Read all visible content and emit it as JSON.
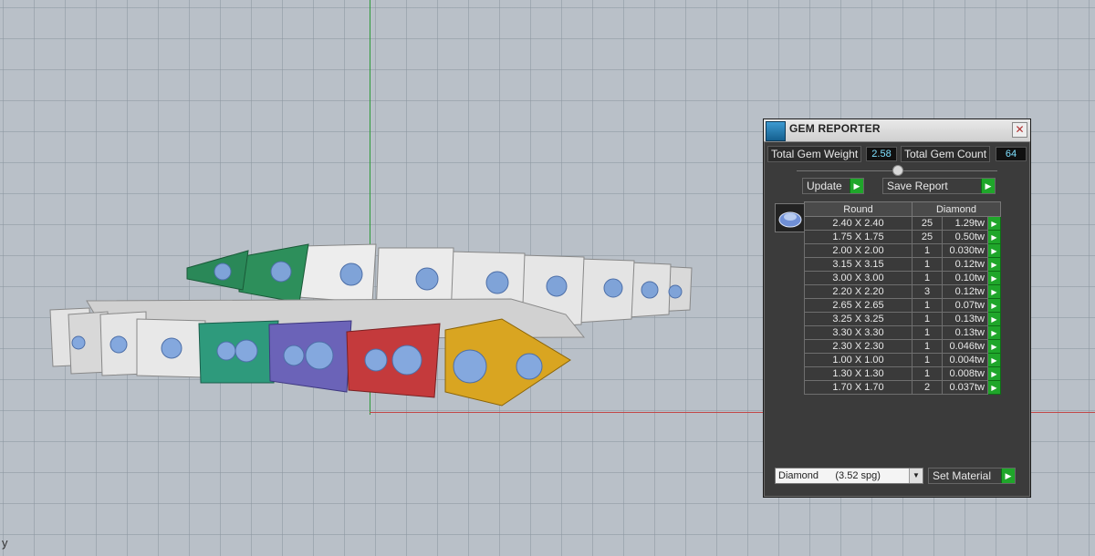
{
  "corner_label": "y",
  "panel": {
    "title": "GEM REPORTER",
    "close_icon": "close-icon",
    "total_weight_label": "Total Gem Weight",
    "total_weight_value": "2.58",
    "total_count_label": "Total Gem Count",
    "total_count_value": "64",
    "update_label": "Update",
    "save_report_label": "Save Report",
    "set_material_label": "Set Material",
    "material_value": "Diamond      (3.52 spg)",
    "accent_green": "#1fa62a"
  },
  "table": {
    "shape_header": "Round",
    "material_header": "Diamond",
    "rows": [
      {
        "size": "2.40 X 2.40",
        "count": "25",
        "weight": "1.29tw"
      },
      {
        "size": "1.75 X 1.75",
        "count": "25",
        "weight": "0.50tw"
      },
      {
        "size": "2.00 X 2.00",
        "count": "1",
        "weight": "0.030tw"
      },
      {
        "size": "3.15 X 3.15",
        "count": "1",
        "weight": "0.12tw"
      },
      {
        "size": "3.00 X 3.00",
        "count": "1",
        "weight": "0.10tw"
      },
      {
        "size": "2.20 X 2.20",
        "count": "3",
        "weight": "0.12tw"
      },
      {
        "size": "2.65 X 2.65",
        "count": "1",
        "weight": "0.07tw"
      },
      {
        "size": "3.25 X 3.25",
        "count": "1",
        "weight": "0.13tw"
      },
      {
        "size": "3.30 X 3.30",
        "count": "1",
        "weight": "0.13tw"
      },
      {
        "size": "2.30 X 2.30",
        "count": "1",
        "weight": "0.046tw"
      },
      {
        "size": "1.00 X 1.00",
        "count": "1",
        "weight": "0.004tw"
      },
      {
        "size": "1.30 X 1.30",
        "count": "1",
        "weight": "0.008tw"
      },
      {
        "size": "1.70 X 1.70",
        "count": "2",
        "weight": "0.037tw"
      }
    ]
  }
}
